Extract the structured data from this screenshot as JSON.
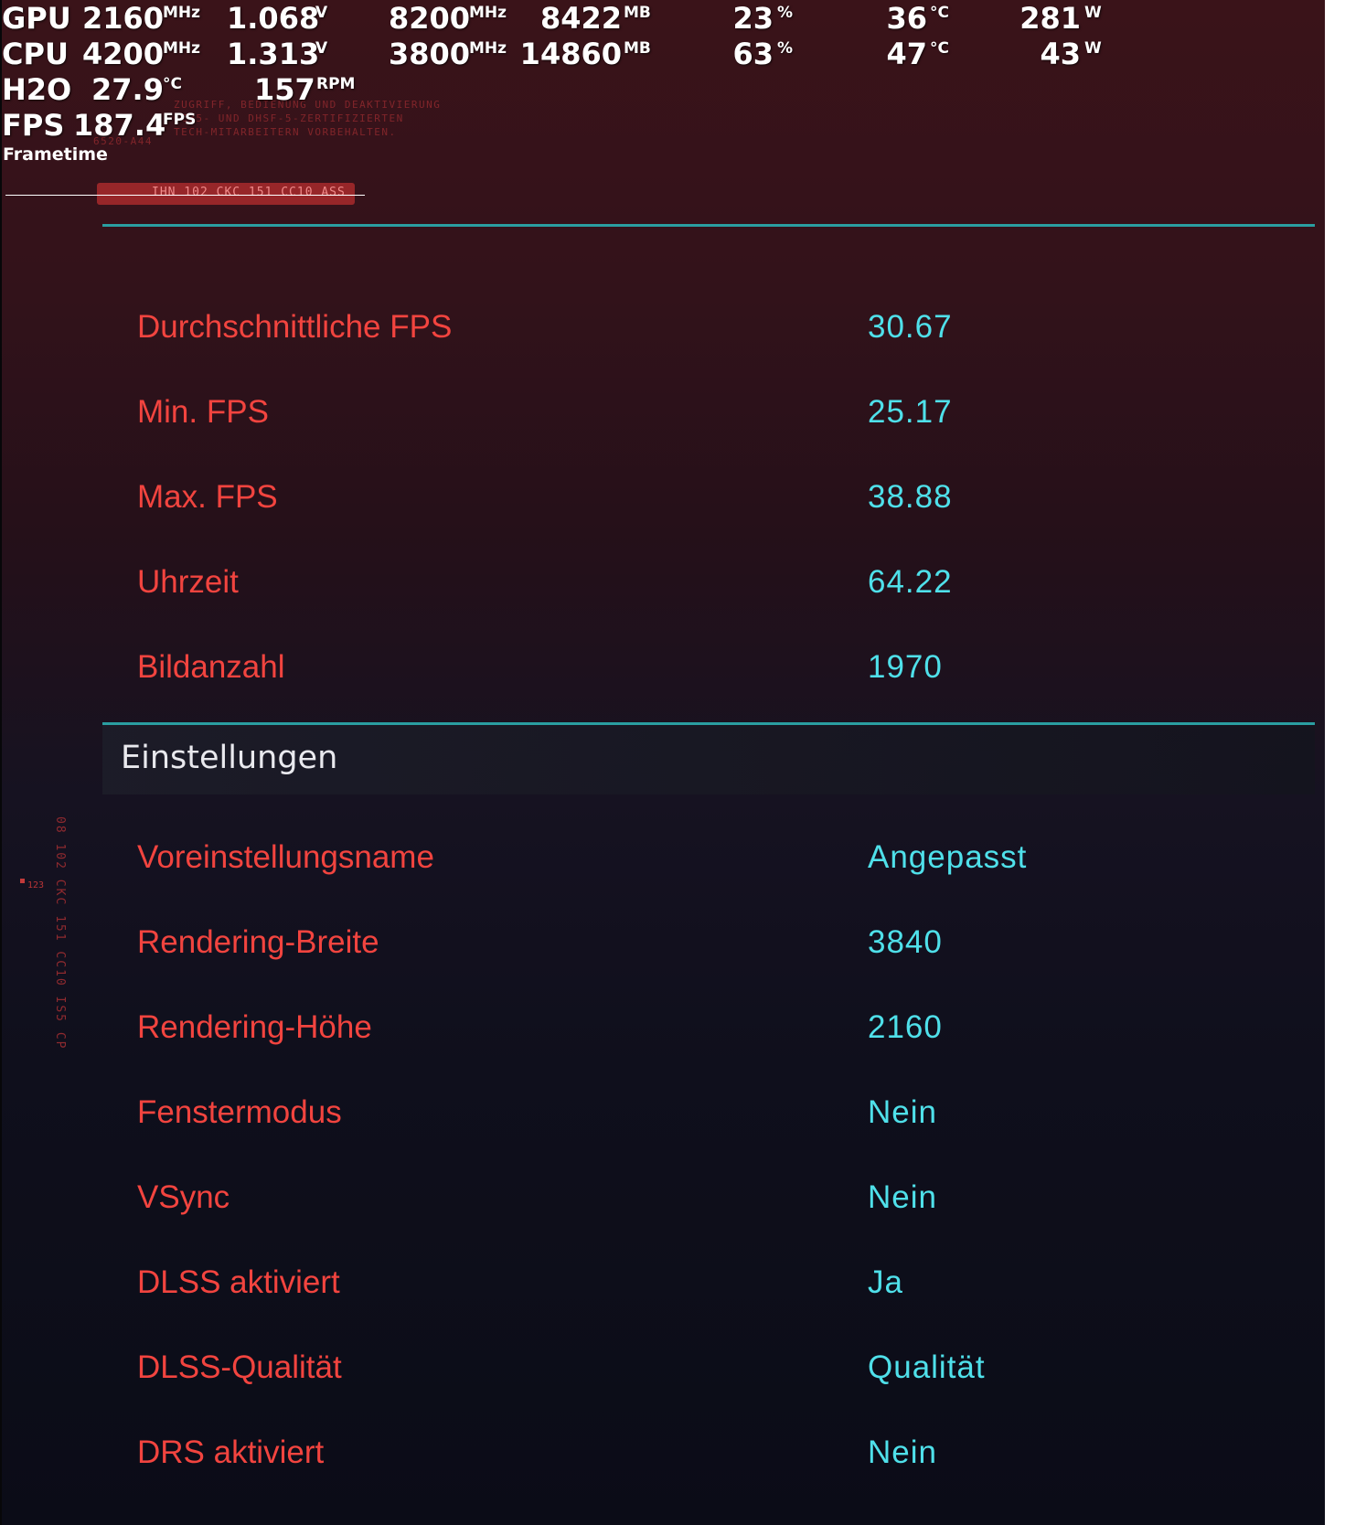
{
  "osd": {
    "gpu": {
      "label": "GPU",
      "clock": "2160",
      "clock_unit": "MHz",
      "voltage": "1.068",
      "voltage_unit": "V",
      "mem_clock": "8200",
      "mem_clock_unit": "MHz",
      "mem_used": "8422",
      "mem_used_unit": "MB",
      "load": "23",
      "load_unit": "%",
      "temp": "36",
      "temp_unit": "°C",
      "power": "281",
      "power_unit": "W"
    },
    "cpu": {
      "label": "CPU",
      "clock": "4200",
      "clock_unit": "MHz",
      "voltage": "1.313",
      "voltage_unit": "V",
      "mem_clock": "3800",
      "mem_clock_unit": "MHz",
      "mem_used": "14860",
      "mem_used_unit": "MB",
      "load": "63",
      "load_unit": "%",
      "temp": "47",
      "temp_unit": "°C",
      "power": "43",
      "power_unit": "W"
    },
    "h2o": {
      "label": "H2O",
      "temp": "27.9",
      "temp_unit": "°C",
      "pump": "157",
      "pump_unit": "RPM"
    },
    "fps": {
      "label": "FPS",
      "value": "187.4",
      "unit": "FPS"
    },
    "frametime": {
      "label": "Frametime"
    }
  },
  "background_decoration": {
    "notice_lines": [
      "ZUGRIFF, BEDIENUNG UND DEAKTIVIERUNG",
      "CC35- UND DHSF-5-ZERTIFIZIERTEN",
      "TECH-MITARBEITERN VORBEHALTEN."
    ],
    "code_small": "6520-A44",
    "bar_text": "IHN 102 CKC 151 CC10 ASS",
    "vertical_text": "08 102 CKC 151 CC10 IS5 CP",
    "small_tag": "123"
  },
  "results": [
    {
      "label": "Durchschnittliche FPS",
      "value": "30.67"
    },
    {
      "label": "Min. FPS",
      "value": "25.17"
    },
    {
      "label": "Max. FPS",
      "value": "38.88"
    },
    {
      "label": "Uhrzeit",
      "value": "64.22"
    },
    {
      "label": "Bildanzahl",
      "value": "1970"
    }
  ],
  "settings": {
    "title": "Einstellungen",
    "rows": [
      {
        "label": "Voreinstellungsname",
        "value": "Angepasst"
      },
      {
        "label": "Rendering-Breite",
        "value": "3840"
      },
      {
        "label": "Rendering-Höhe",
        "value": "2160"
      },
      {
        "label": "Fenstermodus",
        "value": "Nein"
      },
      {
        "label": "VSync",
        "value": "Nein"
      },
      {
        "label": "DLSS aktiviert",
        "value": "Ja"
      },
      {
        "label": "DLSS-Qualität",
        "value": "Qualität"
      },
      {
        "label": "DRS aktiviert",
        "value": "Nein"
      }
    ]
  },
  "colors": {
    "label_red": "#f2443f",
    "value_cyan": "#4fe0ea",
    "rule_teal": "#2a9ea1",
    "header_text": "#e9e9ee"
  }
}
